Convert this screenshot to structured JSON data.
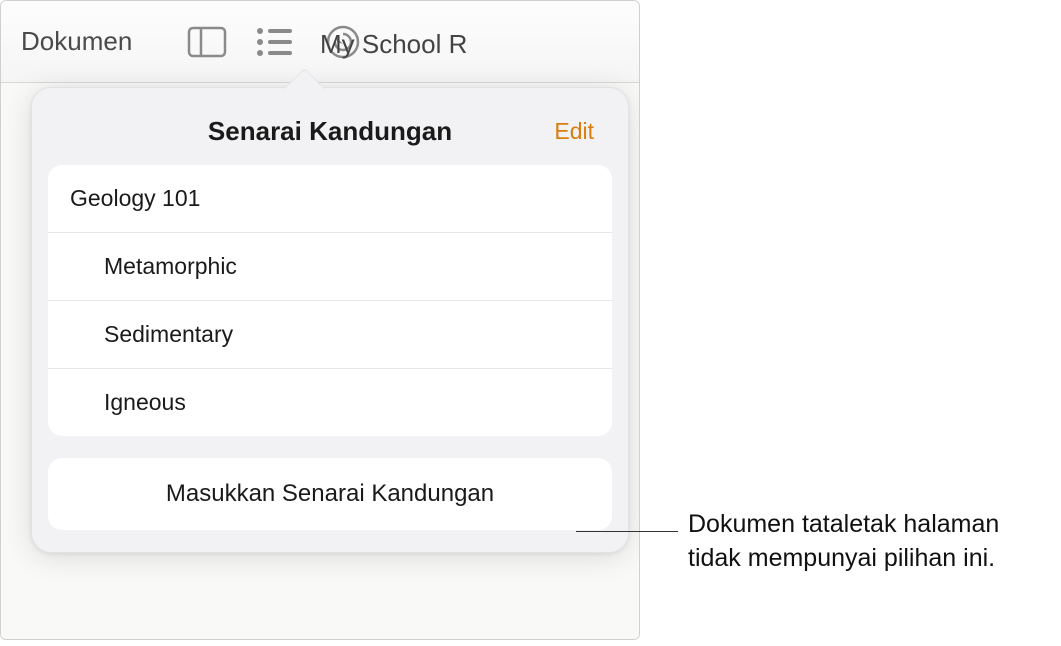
{
  "toolbar": {
    "back_label": "Dokumen",
    "doc_title": "My School R"
  },
  "popover": {
    "title": "Senarai Kandungan",
    "edit_label": "Edit",
    "items": [
      {
        "label": "Geology 101",
        "level": 1
      },
      {
        "label": "Metamorphic",
        "level": 2
      },
      {
        "label": "Sedimentary",
        "level": 2
      },
      {
        "label": "Igneous",
        "level": 2
      }
    ],
    "insert_label": "Masukkan Senarai Kandungan"
  },
  "callout": {
    "line1": "Dokumen tataletak halaman",
    "line2": "tidak mempunyai pilihan ini."
  }
}
